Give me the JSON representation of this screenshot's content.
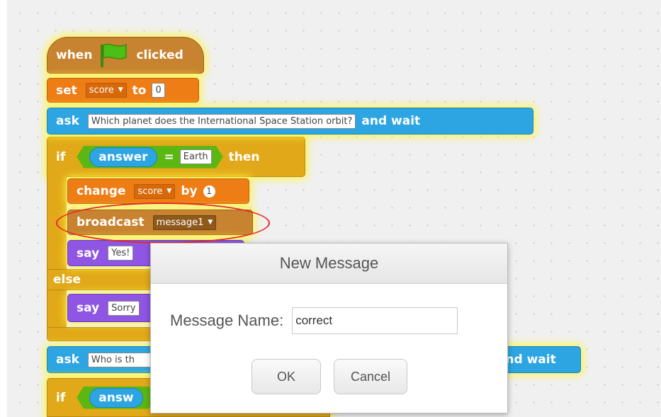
{
  "script": {
    "hat": {
      "when": "when",
      "clicked": "clicked"
    },
    "set": {
      "label": "set",
      "var": "score",
      "to": "to",
      "value": "0"
    },
    "ask1": {
      "label": "ask",
      "question": "Which planet does the International Space Station orbit?",
      "wait": "and wait"
    },
    "if1": {
      "label": "if",
      "reporter": "answer",
      "op": "=",
      "value": "Earth",
      "then": "then"
    },
    "change": {
      "label": "change",
      "var": "score",
      "by": "by",
      "value": "1"
    },
    "broadcast": {
      "label": "broadcast",
      "message": "message1"
    },
    "say1": {
      "label": "say",
      "text": "Yes!"
    },
    "else_label": "else",
    "say2": {
      "label": "say",
      "text": "Sorry"
    },
    "ask2": {
      "label": "ask",
      "question": "Who is th",
      "wait": "and wait"
    },
    "if2": {
      "label": "if",
      "reporter": "answ"
    }
  },
  "dialog": {
    "title": "New Message",
    "label": "Message Name:",
    "input_value": "correct",
    "ok": "OK",
    "cancel": "Cancel"
  },
  "colors": {
    "events": "#c88330",
    "data": "#ee7d16",
    "sensing": "#2ca5e2",
    "control": "#e1a91a",
    "looks": "#8f56e3",
    "highlight": "#e5272a"
  }
}
